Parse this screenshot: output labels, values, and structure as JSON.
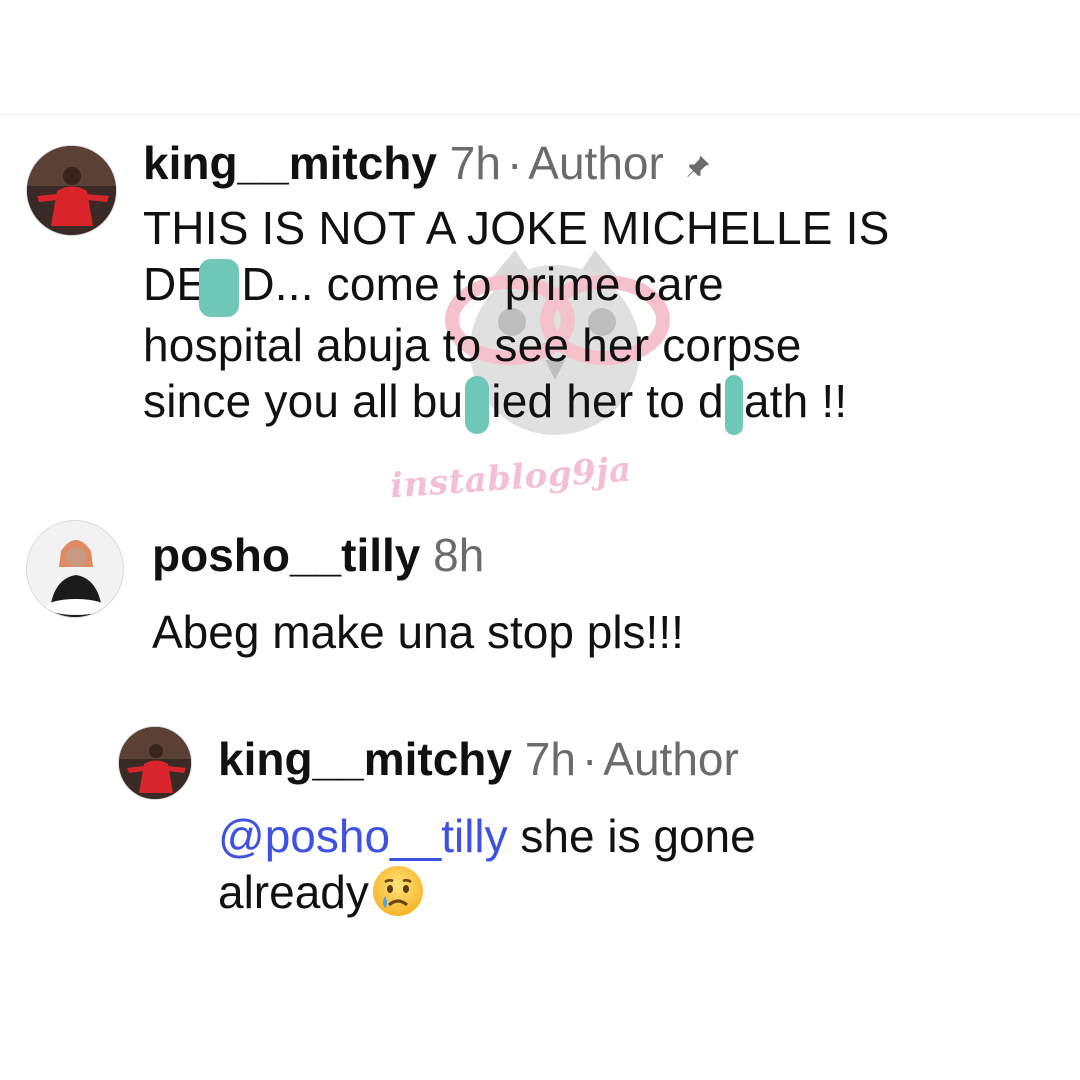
{
  "comments": [
    {
      "username": "king__mitchy",
      "time": "7h",
      "badge": "Author",
      "pinned": true,
      "text_line1": "THIS IS NOT A JOKE MICHELLE IS",
      "text_line2a": "DE",
      "text_line2b": "D...  come to prime care",
      "text_line3": "hospital abuja to see her corpse",
      "text_line4a": "since you all bu",
      "text_line4b": "ied her to d",
      "text_line4c": "ath !!"
    },
    {
      "username": "posho__tilly",
      "time": "8h",
      "text": "Abeg make una stop pls!!!"
    },
    {
      "username": "king__mitchy",
      "time": "7h",
      "badge": "Author",
      "mention": "@posho__tilly",
      "text_a": " she is gone",
      "text_b": "already"
    }
  ],
  "watermark": "instablog9ja",
  "icons": {
    "pin": "pin-icon",
    "crying_emoji": "crying-face-emoji"
  },
  "colors": {
    "mention": "#3f51e0",
    "meta": "#6b6b6b",
    "redaction": "#6fc7b7",
    "watermark": "#f3b3cf"
  }
}
